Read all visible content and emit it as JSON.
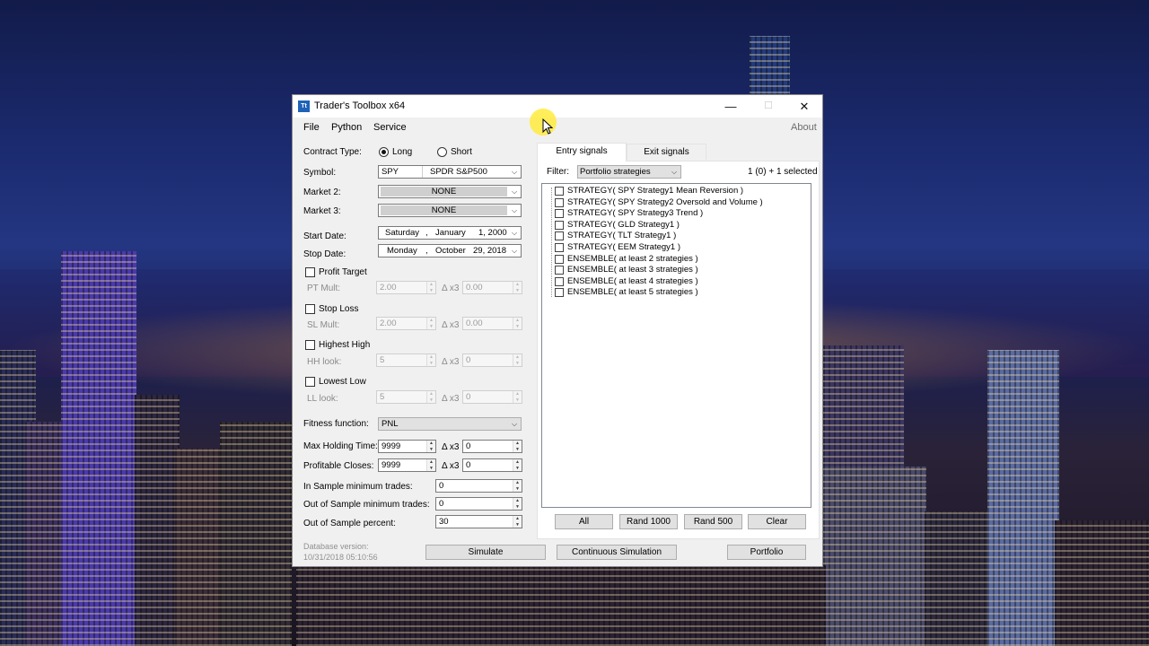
{
  "window": {
    "title": "Trader's Toolbox x64",
    "icon_text": "Tt",
    "minimize_glyph": "—",
    "maximize_glyph": "☐",
    "close_glyph": "✕"
  },
  "menu": [
    "File",
    "Python",
    "Service"
  ],
  "about": "About",
  "form": {
    "contract_type_label": "Contract Type:",
    "long_label": "Long",
    "short_label": "Short",
    "contract_type_selected": "Long",
    "symbol_label": "Symbol:",
    "symbol_ticker": "SPY",
    "symbol_name": "SPDR S&P500",
    "market2_label": "Market 2:",
    "market2_value": "NONE",
    "market3_label": "Market 3:",
    "market3_value": "NONE",
    "start_date_label": "Start Date:",
    "start_date": {
      "weekday": "Saturday",
      "sep": ",",
      "month": "January",
      "day_year": "1, 2000"
    },
    "stop_date_label": "Stop Date:",
    "stop_date": {
      "weekday": "Monday",
      "sep": ",",
      "month": "October",
      "day_year": "29, 2018"
    },
    "profit_target_label": "Profit Target",
    "pt_mult_label": "PT Mult:",
    "pt_mult": "2.00",
    "pt_delta": "0.00",
    "stop_loss_label": "Stop Loss",
    "sl_mult_label": "SL Mult:",
    "sl_mult": "2.00",
    "sl_delta": "0.00",
    "highest_high_label": "Highest High",
    "hh_look_label": "HH look:",
    "hh_look": "5",
    "hh_delta": "0",
    "lowest_low_label": "Lowest Low",
    "ll_look_label": "LL look:",
    "ll_look": "5",
    "ll_delta": "0",
    "delta_label": "Δ x3",
    "fitness_label": "Fitness function:",
    "fitness_value": "PNL",
    "max_holding_label": "Max Holding Time:",
    "max_holding": "9999",
    "max_holding_delta": "0",
    "profitable_closes_label": "Profitable Closes:",
    "profitable_closes": "9999",
    "profitable_closes_delta": "0",
    "is_min_trades_label": "In Sample minimum trades:",
    "is_min_trades": "0",
    "oos_min_trades_label": "Out of Sample minimum trades:",
    "oos_min_trades": "0",
    "oos_percent_label": "Out of Sample percent:",
    "oos_percent": "30"
  },
  "tabs": [
    "Entry signals",
    "Exit signals"
  ],
  "filter": {
    "label": "Filter:",
    "value": "Portfolio strategies",
    "selection_count": "1 (0) + 1 selected"
  },
  "signals": [
    "STRATEGY( SPY Strategy1 Mean Reversion )",
    "STRATEGY( SPY Strategy2 Oversold and Volume )",
    "STRATEGY( SPY Strategy3 Trend )",
    "STRATEGY( GLD Strategy1 )",
    "STRATEGY( TLT Strategy1 )",
    "STRATEGY( EEM Strategy1 )",
    "ENSEMBLE( at least 2 strategies )",
    "ENSEMBLE( at least 3 strategies )",
    "ENSEMBLE( at least 4 strategies )",
    "ENSEMBLE( at least 5 strategies )"
  ],
  "list_buttons": [
    "All",
    "Rand 1000",
    "Rand 500",
    "Clear"
  ],
  "footer": {
    "db_version_label": "Database version:",
    "db_version_date": "10/31/2018 05:10:56",
    "simulate": "Simulate",
    "continuous": "Continuous Simulation",
    "portfolio": "Portfolio"
  }
}
